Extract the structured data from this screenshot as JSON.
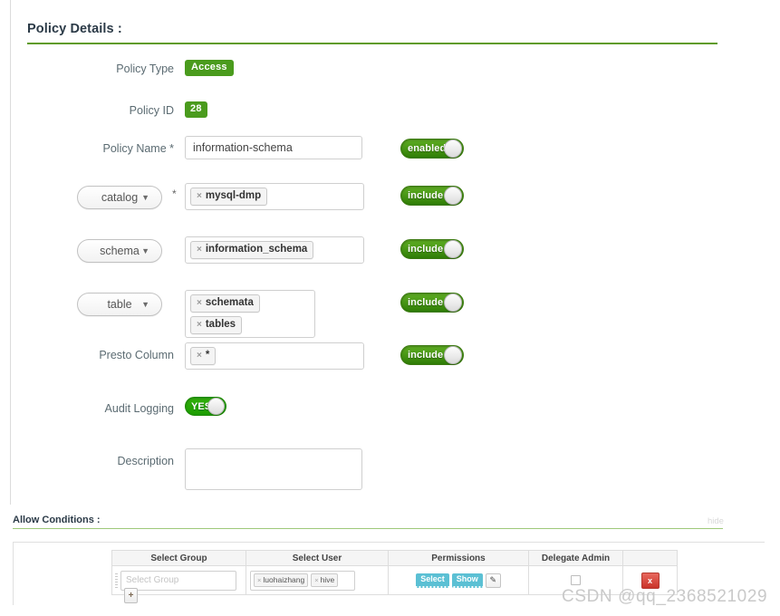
{
  "policy_details": {
    "section_title": "Policy Details :",
    "rows": {
      "policy_type": {
        "label": "Policy Type",
        "value": "Access"
      },
      "policy_id": {
        "label": "Policy ID",
        "value": "28"
      },
      "policy_name": {
        "label": "Policy Name *",
        "value": "information-schema",
        "placeholder": "Policy Name",
        "toggle": "enabled"
      },
      "catalog": {
        "label": "catalog",
        "required_mark": "*",
        "chevron": "chevron-down-icon",
        "tags": [
          "mysql-dmp"
        ],
        "toggle": "include"
      },
      "schema": {
        "label": "schema",
        "chevron": "chevron-down-icon",
        "tags": [
          "information_schema"
        ],
        "toggle": "include"
      },
      "table": {
        "label": "table",
        "chevron": "chevron-down-icon",
        "tags": [
          "schemata",
          "tables"
        ],
        "toggle": "include"
      },
      "presto_column": {
        "label": "Presto Column",
        "tags": [
          "*"
        ],
        "toggle": "include"
      },
      "audit_logging": {
        "label": "Audit Logging",
        "toggle": "YES"
      },
      "description": {
        "label": "Description",
        "value": "",
        "placeholder": ""
      }
    },
    "tag_remove_icon": "×"
  },
  "allow_conditions": {
    "title": "Allow Conditions :",
    "hide_link": "hide",
    "columns": [
      "Select Group",
      "Select User",
      "Permissions",
      "Delegate Admin",
      ""
    ],
    "rows": [
      {
        "group_placeholder": "Select Group",
        "group_value": "",
        "users": [
          "luohaizhang",
          "hive"
        ],
        "permissions": [
          "Select",
          "Show"
        ],
        "edit_icon": "pencil-icon",
        "delegate_admin_checked": false,
        "delete_label": "x"
      }
    ],
    "add_row_label": "+"
  },
  "watermark": "CSDN @qq_2368521029",
  "colors": {
    "green_badge": "#4a9b1d",
    "green_rule": "#5f9b22",
    "toggle_green": "#2f7d06",
    "audit_green": "#1c9d00",
    "perm_badge": "#5bc0d4",
    "delete_red": "#c9342a"
  }
}
